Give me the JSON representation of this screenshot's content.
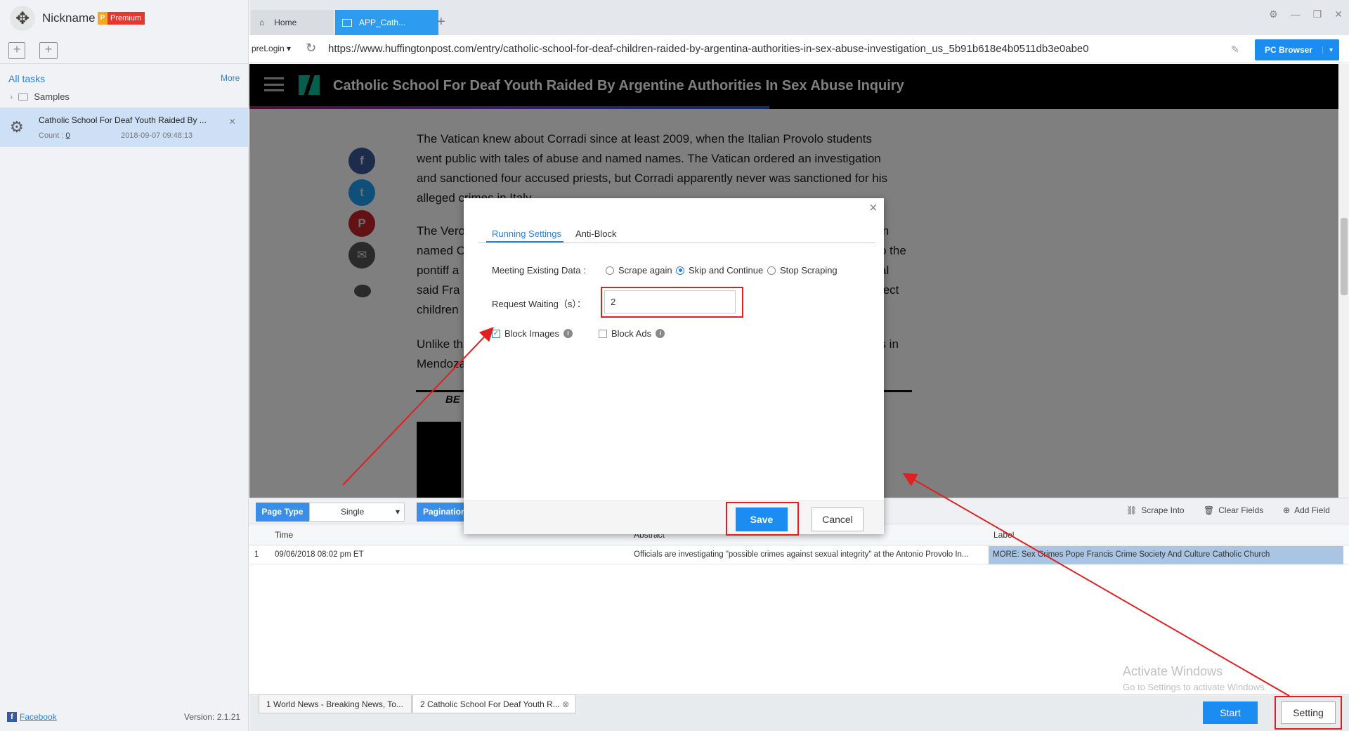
{
  "sidebar": {
    "nickname": "Nickname",
    "premium_badge": "Premium",
    "premium_letter": "P",
    "all_tasks": "All tasks",
    "more": "More",
    "samples": "Samples",
    "task": {
      "title": "Catholic School For Deaf Youth Raided By ...",
      "count_label": "Count :",
      "count_value": "0",
      "date": "2018-09-07 09:48:13"
    },
    "facebook": "Facebook",
    "version": "Version: 2.1.21"
  },
  "tabs": {
    "home": "Home",
    "app": "APP_Cath..."
  },
  "address": {
    "prelogin": "preLogin",
    "url": "https://www.huffingtonpost.com/entry/catholic-school-for-deaf-children-raided-by-argentina-authorities-in-sex-abuse-investigation_us_5b91b618e4b0511db3e0abe0",
    "pc_browser": "PC Browser"
  },
  "page": {
    "headline": "Catholic School For Deaf Youth Raided By Argentine Authorities In Sex Abuse Inquiry",
    "p1_lines": [
      "The Vatican knew about Corradi since at least 2009, when the Italian Provolo students",
      "went public with tales of abuse and named names. The Vatican ordered an investigation",
      "and sanctioned four accused priests, but Corradi apparently never was sanctioned for his",
      "alleged crimes in Italy."
    ],
    "p2_lines": [
      "The Vero",
      "named C",
      "pontiff a",
      "said Fra",
      "children"
    ],
    "p2_right": [
      "in",
      "o the",
      "al",
      "tect"
    ],
    "p3_lines": [
      "Unlike th",
      "Mendoza"
    ],
    "p3_right": [
      "es in"
    ],
    "be_text": "BE"
  },
  "modal": {
    "tab_running": "Running Settings",
    "tab_antiblock": "Anti-Block",
    "meeting_label": "Meeting Existing Data :",
    "radio_scrape_again": "Scrape again",
    "radio_skip": "Skip and Continue",
    "radio_stop": "Stop Scraping",
    "selected_option": "Skip and Continue",
    "wait_label": "Request Waiting（s）：",
    "wait_value": "2",
    "block_images": "Block Images",
    "block_images_checked": true,
    "block_ads": "Block Ads",
    "block_ads_checked": false,
    "save": "Save",
    "cancel": "Cancel"
  },
  "toolbar": {
    "page_type": "Page Type",
    "page_type_value": "Single",
    "pagination": "Pagination",
    "scrape_into": "Scrape Into",
    "clear_fields": "Clear Fields",
    "add_field": "Add Field"
  },
  "grid": {
    "columns": [
      "Time",
      "Abstract",
      "Label"
    ],
    "rows": [
      {
        "index": "1",
        "time": "09/06/2018 08:02 pm ET",
        "abstract": "Officials are investigating \"possible crimes against sexual integrity\" at the Antonio Provolo In...",
        "label": "MORE: Sex Crimes Pope Francis Crime Society And Culture Catholic Church"
      }
    ]
  },
  "windows": {
    "activate": "Activate Windows",
    "activate_sub": "Go to Settings to activate Windows."
  },
  "bottom": {
    "tab1": "1 World News - Breaking News, To...",
    "tab2": "2 Catholic School For Deaf Youth R...",
    "start": "Start",
    "setting": "Setting"
  },
  "colors": {
    "accent": "#1a8cf2",
    "highlight": "#e02020",
    "huffpost_green": "#0dbe98"
  }
}
